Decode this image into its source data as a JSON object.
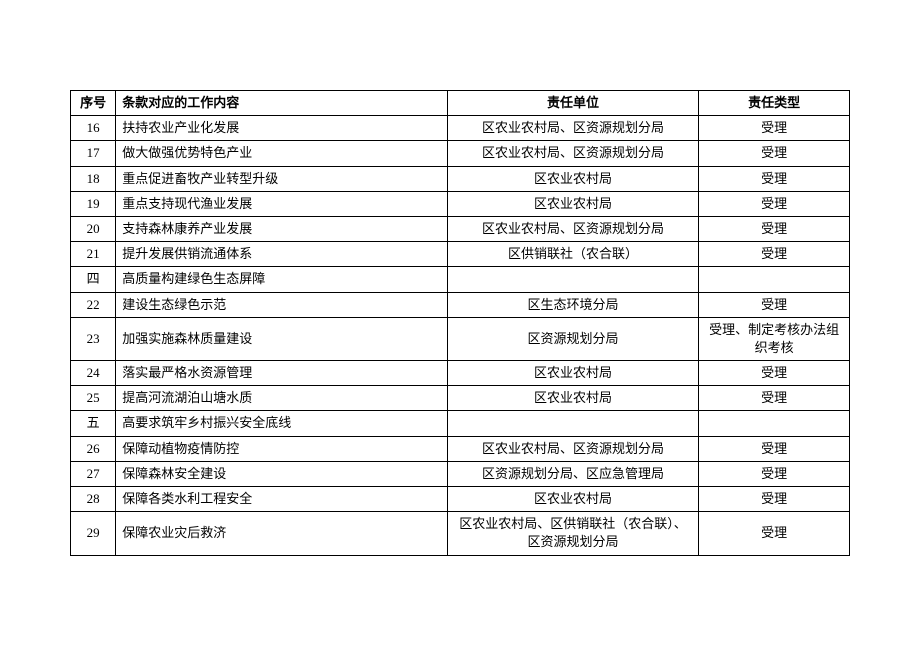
{
  "headers": {
    "seq": "序号",
    "content": "条款对应的工作内容",
    "unit": "责任单位",
    "type": "责任类型"
  },
  "rows": [
    {
      "seq": "16",
      "content": "扶持农业产业化发展",
      "unit": "区农业农村局、区资源规划分局",
      "type": "受理"
    },
    {
      "seq": "17",
      "content": "做大做强优势特色产业",
      "unit": "区农业农村局、区资源规划分局",
      "type": "受理"
    },
    {
      "seq": "18",
      "content": "重点促进畜牧产业转型升级",
      "unit": "区农业农村局",
      "type": "受理"
    },
    {
      "seq": "19",
      "content": "重点支持现代渔业发展",
      "unit": "区农业农村局",
      "type": "受理"
    },
    {
      "seq": "20",
      "content": "支持森林康养产业发展",
      "unit": "区农业农村局、区资源规划分局",
      "type": "受理"
    },
    {
      "seq": "21",
      "content": "提升发展供销流通体系",
      "unit": "区供销联社（农合联）",
      "type": "受理"
    },
    {
      "seq": "四",
      "content": "高质量构建绿色生态屏障",
      "unit": "",
      "type": "",
      "section": true
    },
    {
      "seq": "22",
      "content": "建设生态绿色示范",
      "unit": "区生态环境分局",
      "type": "受理"
    },
    {
      "seq": "23",
      "content": "加强实施森林质量建设",
      "unit": "区资源规划分局",
      "type": "受理、制定考核办法组织考核"
    },
    {
      "seq": "24",
      "content": "落实最严格水资源管理",
      "unit": "区农业农村局",
      "type": "受理"
    },
    {
      "seq": "25",
      "content": "提高河流湖泊山塘水质",
      "unit": "区农业农村局",
      "type": "受理"
    },
    {
      "seq": "五",
      "content": "高要求筑牢乡村振兴安全底线",
      "unit": "",
      "type": "",
      "section": true
    },
    {
      "seq": "26",
      "content": "保障动植物疫情防控",
      "unit": "区农业农村局、区资源规划分局",
      "type": "受理"
    },
    {
      "seq": "27",
      "content": "保障森林安全建设",
      "unit": "区资源规划分局、区应急管理局",
      "type": "受理"
    },
    {
      "seq": "28",
      "content": "保障各类水利工程安全",
      "unit": "区农业农村局",
      "type": "受理"
    },
    {
      "seq": "29",
      "content": "保障农业灾后救济",
      "unit": "区农业农村局、区供销联社（农合联）、区资源规划分局",
      "type": "受理"
    }
  ]
}
